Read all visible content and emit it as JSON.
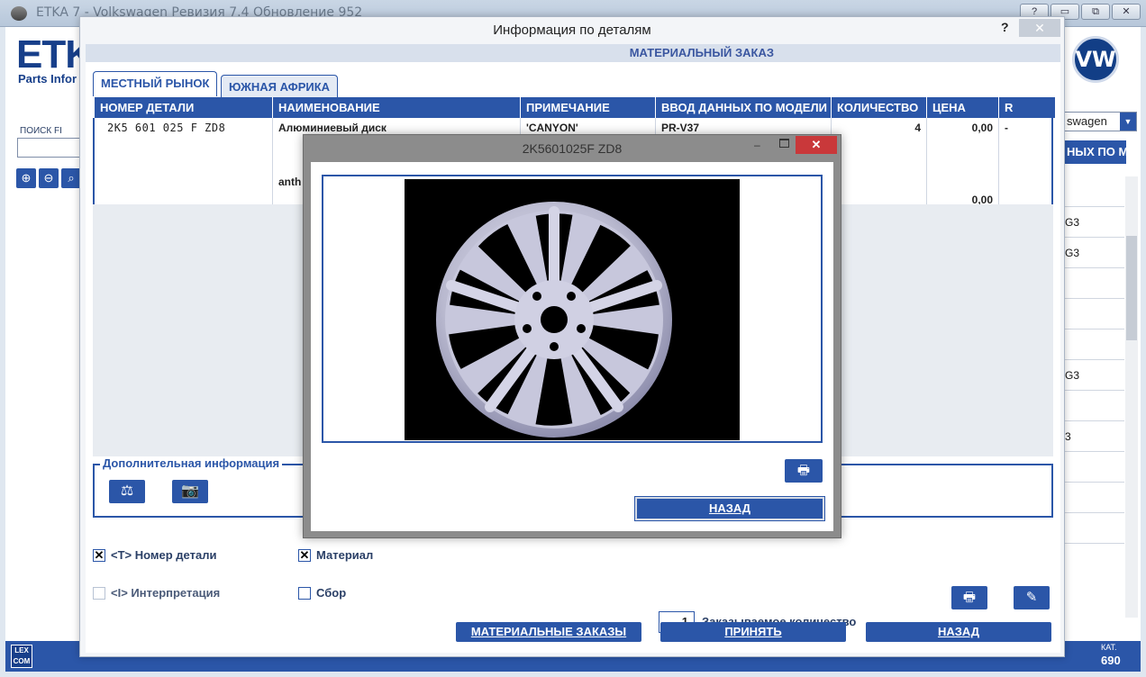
{
  "app": {
    "title": "ETKA 7 - Volkswagen Ревизия 7.4 Обновление 952",
    "logo": "ETK",
    "subtitle": "Parts Infor",
    "search_label": "ПОИСК FI",
    "right_select": "swagen",
    "right_header": "НЫХ ПО М",
    "right_lines": [
      "",
      "G3",
      "G3",
      "",
      "",
      "",
      "G3",
      "",
      "3",
      "",
      "",
      ""
    ],
    "bottom_badge": "LEX COM",
    "kat_label": "КАТ.",
    "kat_value": "690"
  },
  "dialog": {
    "title": "Информация по деталям",
    "help": "?",
    "close": "✕",
    "section_header": "МАТЕРИАЛЬНЫЙ ЗАКАЗ",
    "tabs": [
      {
        "label": "МЕСТНЫЙ РЫНОК",
        "active": true
      },
      {
        "label": "ЮЖНАЯ АФРИКА",
        "active": false
      }
    ],
    "columns": [
      "НОМЕР ДЕТАЛИ",
      "НАИМЕНОВАНИЕ",
      "ПРИМЕЧАНИЕ",
      "ВВОД ДАННЫХ ПО МОДЕЛИ",
      "КОЛИЧЕСТВО",
      "ЦЕНА",
      "R"
    ],
    "row": {
      "part_number": "2K5 601 025 F  ZD8",
      "name": "Алюминиевый диск",
      "name_extra": "anth",
      "note": "'CANYON'",
      "model": "PR-V37",
      "quantity": "4",
      "price": "0,00",
      "price_total": "0,00",
      "r": "-"
    },
    "additional_info_title": "Дополнительная информация",
    "checkboxes": {
      "part_number": {
        "label": "<T> Номер детали",
        "checked": true
      },
      "material": {
        "label": "Материал",
        "checked": true
      },
      "interpretation": {
        "label": "<I> Интерпретация",
        "checked": false
      },
      "assembly": {
        "label": "Сбор",
        "checked": false
      }
    },
    "order_qty_value": "1",
    "order_qty_label": "Заказываемое количество",
    "buttons": {
      "material_orders": "МАТЕРИАЛЬНЫЕ ЗАКАЗЫ",
      "accept": "ПРИНЯТЬ",
      "back": "НАЗАД"
    }
  },
  "popup": {
    "title": "2K5601025F ZD8",
    "back_button": "НАЗАД"
  },
  "colors": {
    "accent": "#2b56a8",
    "close_red": "#c9383a"
  }
}
